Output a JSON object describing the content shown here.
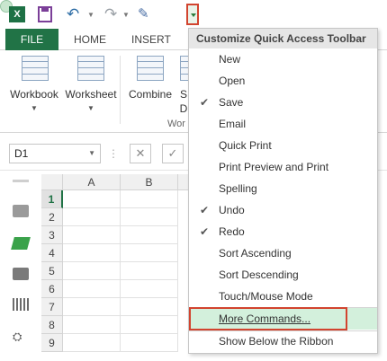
{
  "colors": {
    "file_tab": "#217346",
    "highlight": "#d3f0dc",
    "callout": "#d2442f"
  },
  "qat": {
    "app_icon_letter": "X",
    "icons": [
      "excel-icon",
      "save-icon",
      "undo-icon",
      "redo-icon",
      "pen-icon",
      "circle-icon",
      "dropdown-arrow-icon"
    ]
  },
  "tabs": [
    "FILE",
    "HOME",
    "INSERT"
  ],
  "ribbon": {
    "buttons": [
      {
        "label": "Workbook"
      },
      {
        "label": "Worksheet"
      },
      {
        "label": "Combine"
      },
      {
        "label": "S"
      },
      {
        "label": "D"
      }
    ],
    "group_label": "Wor"
  },
  "formula_bar": {
    "name_box": "D1",
    "cancel": "✕",
    "enter": "✓"
  },
  "sheet": {
    "columns": [
      "A",
      "B"
    ],
    "rows": [
      "1",
      "2",
      "3",
      "4",
      "5",
      "6",
      "7",
      "8",
      "9"
    ]
  },
  "menu": {
    "title": "Customize Quick Access Toolbar",
    "items": [
      {
        "label": "New",
        "checked": false
      },
      {
        "label": "Open",
        "checked": false
      },
      {
        "label": "Save",
        "checked": true
      },
      {
        "label": "Email",
        "checked": false
      },
      {
        "label": "Quick Print",
        "checked": false
      },
      {
        "label": "Print Preview and Print",
        "checked": false
      },
      {
        "label": "Spelling",
        "checked": false
      },
      {
        "label": "Undo",
        "checked": true
      },
      {
        "label": "Redo",
        "checked": true
      },
      {
        "label": "Sort Ascending",
        "checked": false
      },
      {
        "label": "Sort Descending",
        "checked": false
      },
      {
        "label": "Touch/Mouse Mode",
        "checked": false
      }
    ],
    "more_commands": "More Commands...",
    "show_below": "Show Below the Ribbon"
  }
}
